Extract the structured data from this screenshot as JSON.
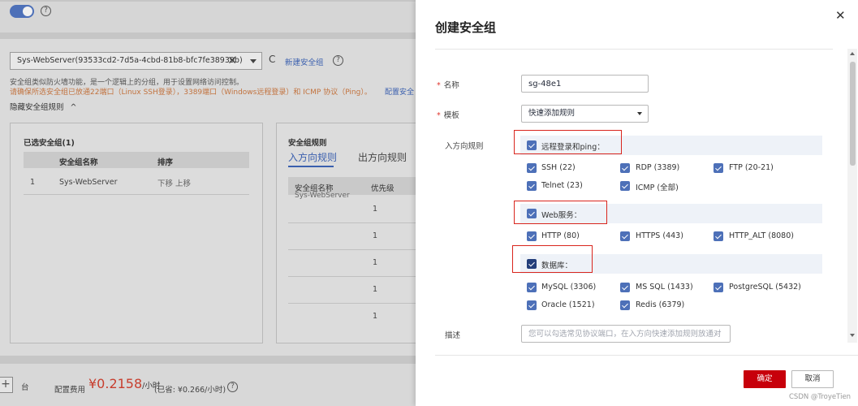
{
  "background": {
    "help_mark": "?",
    "sg_select_value": "Sys-WebServer(93533cd2-7d5a-4cbd-81b8-bfc7fe38939b)",
    "sg_select_clear": "✕",
    "refresh_icon": "refresh-icon",
    "new_sg_link": "新建安全组",
    "info_line": "安全组类似防火墙功能，是一个逻辑上的分组，用于设置网络访问控制。",
    "warn_line": "请确保所选安全组已放通22端口（Linux SSH登录），3389端口（Windows远程登录）和 ICMP 协议（Ping）。",
    "config_link": "配置安全",
    "hide_rules_toggle": "隐藏安全组规则",
    "selected_box": {
      "title": "已选安全组(1)",
      "headers": [
        "安全组名称",
        "排序"
      ],
      "row": {
        "index": "1",
        "name": "Sys-WebServer",
        "actions": "下移  上移"
      }
    },
    "rules_box": {
      "title": "安全组规则",
      "tabs": [
        "入方向规则",
        "出方向规则"
      ],
      "headers": [
        "安全组名称",
        "优先级"
      ],
      "first_name": "Sys-WebServer",
      "priorities": [
        "1",
        "1",
        "1",
        "1",
        "1"
      ]
    },
    "bottom": {
      "plus": "+",
      "unit": "台",
      "fee_label": "配置费用",
      "price": "¥0.2158",
      "price_unit": "/小时",
      "saved": "(已省: ¥0.266/小时)"
    }
  },
  "modal": {
    "title": "创建安全组",
    "close_icon": "close-icon",
    "name_label": "名称",
    "name_value": "sg-48e1",
    "template_label": "模板",
    "template_value": "快速添加规则",
    "inbound_label": "入方向规则",
    "groups": [
      {
        "label": "远程登录和ping：",
        "options": [
          "SSH (22)",
          "RDP (3389)",
          "FTP (20-21)",
          "Telnet (23)",
          "ICMP (全部)"
        ]
      },
      {
        "label": "Web服务：",
        "options": [
          "HTTP (80)",
          "HTTPS (443)",
          "HTTP_ALT (8080)"
        ]
      },
      {
        "label": "数据库：",
        "options": [
          "MySQL (3306)",
          "MS SQL (1433)",
          "PostgreSQL (5432)",
          "Oracle (1521)",
          "Redis (6379)"
        ]
      }
    ],
    "desc_label": "描述",
    "desc_placeholder": "您可以勾选常见协议端口，在入方向快速添加规则放通对",
    "confirm": "确定",
    "cancel": "取消",
    "watermark": "CSDN @TroyeTien",
    "colors": {
      "primary": "#c7000b",
      "checkbox": "#4d70b8",
      "highlight": "#d9251d"
    }
  }
}
